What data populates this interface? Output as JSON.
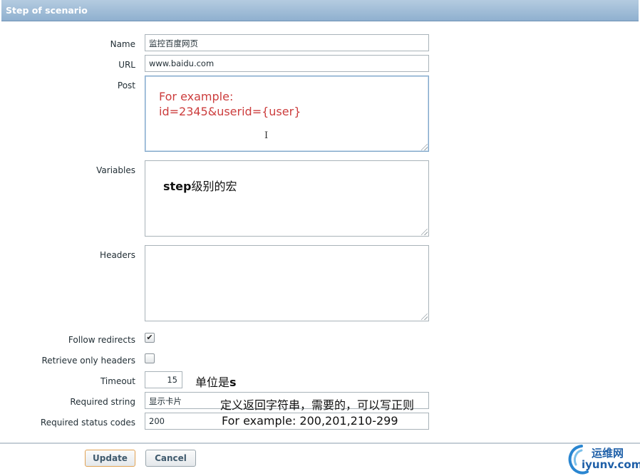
{
  "header": {
    "title": "Step of scenario"
  },
  "form": {
    "name": {
      "label": "Name",
      "value": "监控百度网页"
    },
    "url": {
      "label": "URL",
      "value": "www.baidu.com"
    },
    "post": {
      "label": "Post",
      "annotation_line1": "For example:",
      "annotation_line2": "id=2345&userid={user}"
    },
    "variables": {
      "label": "Variables",
      "annotation_bold": "step",
      "annotation_rest": "级别的宏"
    },
    "headers": {
      "label": "Headers"
    },
    "follow_redirects": {
      "label": "Follow redirects",
      "checked": true,
      "mark": "✔"
    },
    "retrieve_only_headers": {
      "label": "Retrieve only headers",
      "checked": false
    },
    "timeout": {
      "label": "Timeout",
      "value": "15",
      "annotation_text": "单位是",
      "annotation_bold": "s"
    },
    "required_string": {
      "label": "Required string",
      "value": "显示卡片",
      "annotation": "定义返回字符串，需要的，可以写正则"
    },
    "required_status_codes": {
      "label": "Required status codes",
      "value": "200",
      "annotation": "For example: 200,201,210-299"
    }
  },
  "buttons": {
    "update": "Update",
    "cancel": "Cancel"
  },
  "watermark": {
    "cn": "运维网",
    "en": "iyunv.com"
  },
  "colors": {
    "header": "#9bb8d4",
    "annotation_red": "#cc3d3d",
    "update_border": "#e1a253"
  }
}
